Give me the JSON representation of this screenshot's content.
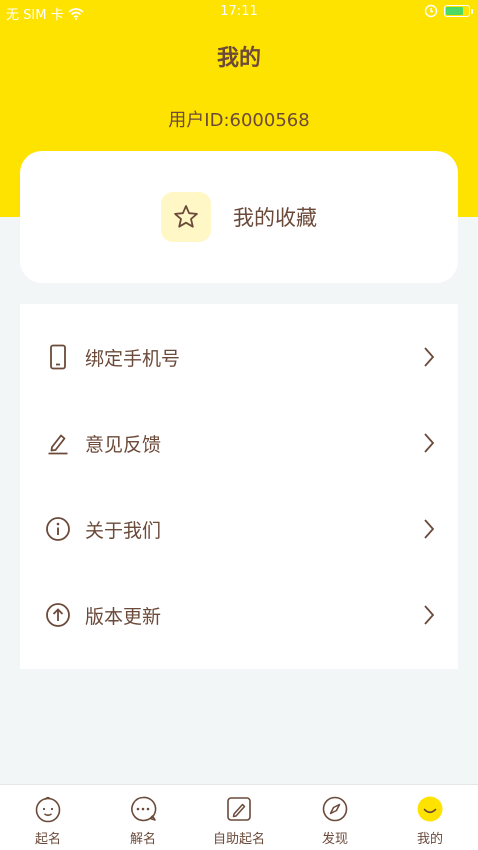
{
  "status_bar": {
    "carrier": "无 SIM 卡",
    "time": "17:11"
  },
  "header": {
    "title": "我的",
    "user_id": "用户ID:6000568"
  },
  "favorites": {
    "label": "我的收藏",
    "icon": "star-icon"
  },
  "menu": {
    "items": [
      {
        "label": "绑定手机号",
        "icon": "phone-icon"
      },
      {
        "label": "意见反馈",
        "icon": "edit-icon"
      },
      {
        "label": "关于我们",
        "icon": "info-icon"
      },
      {
        "label": "版本更新",
        "icon": "upload-icon"
      }
    ]
  },
  "tabbar": {
    "items": [
      {
        "label": "起名",
        "icon": "baby-face-icon"
      },
      {
        "label": "解名",
        "icon": "chat-bubble-icon"
      },
      {
        "label": "自助起名",
        "icon": "pencil-box-icon"
      },
      {
        "label": "发现",
        "icon": "compass-icon"
      },
      {
        "label": "我的",
        "icon": "smile-icon",
        "active": true
      }
    ],
    "active_color": "#ffe300"
  },
  "colors": {
    "brand": "#ffe300",
    "text": "#6b4a3a",
    "background": "#f3f6f7"
  }
}
